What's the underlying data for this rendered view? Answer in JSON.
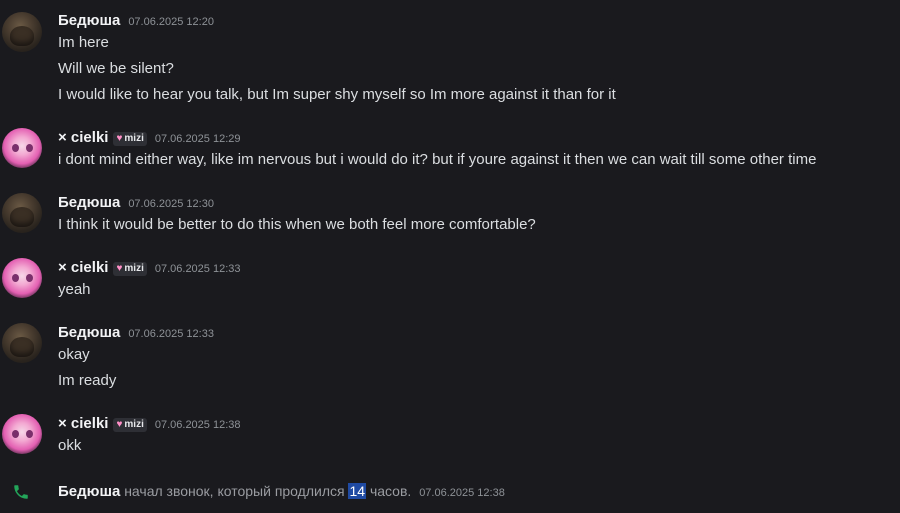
{
  "colors": {
    "background": "#1a1a1e",
    "highlight": "#1f4aa3",
    "phone": "#23a55a",
    "badge_heart": "#ff8fc7"
  },
  "messages": [
    {
      "author": "Бедюша",
      "badge": null,
      "timestamp": "07.06.2025 12:20",
      "avatar": "avatar-bedyusha",
      "lines": [
        "Im here",
        "Will we be silent?",
        "I would like to hear you talk, but Im super shy myself so Im more against it than for it"
      ]
    },
    {
      "author": "× cielki",
      "badge": {
        "icon": "heart-icon",
        "label": "mizi"
      },
      "timestamp": "07.06.2025 12:29",
      "avatar": "avatar-cielki",
      "lines": [
        "i dont mind either way, like im nervous but i would do it? but if youre against it then we can wait till some other time"
      ]
    },
    {
      "author": "Бедюша",
      "badge": null,
      "timestamp": "07.06.2025 12:30",
      "avatar": "avatar-bedyusha",
      "lines": [
        "I think it would be better to do this when we both feel more comfortable?"
      ]
    },
    {
      "author": "× cielki",
      "badge": {
        "icon": "heart-icon",
        "label": "mizi"
      },
      "timestamp": "07.06.2025 12:33",
      "avatar": "avatar-cielki",
      "lines": [
        "yeah"
      ]
    },
    {
      "author": "Бедюша",
      "badge": null,
      "timestamp": "07.06.2025 12:33",
      "avatar": "avatar-bedyusha",
      "lines": [
        "okay",
        "Im ready"
      ]
    },
    {
      "author": "× cielki",
      "badge": {
        "icon": "heart-icon",
        "label": "mizi"
      },
      "timestamp": "07.06.2025 12:38",
      "avatar": "avatar-cielki",
      "lines": [
        "okk"
      ]
    }
  ],
  "call": {
    "icon": "phone-icon",
    "author": "Бедюша",
    "text_before": "начал звонок, который продлился",
    "duration": "14",
    "text_after": "часов.",
    "timestamp": "07.06.2025 12:38"
  }
}
